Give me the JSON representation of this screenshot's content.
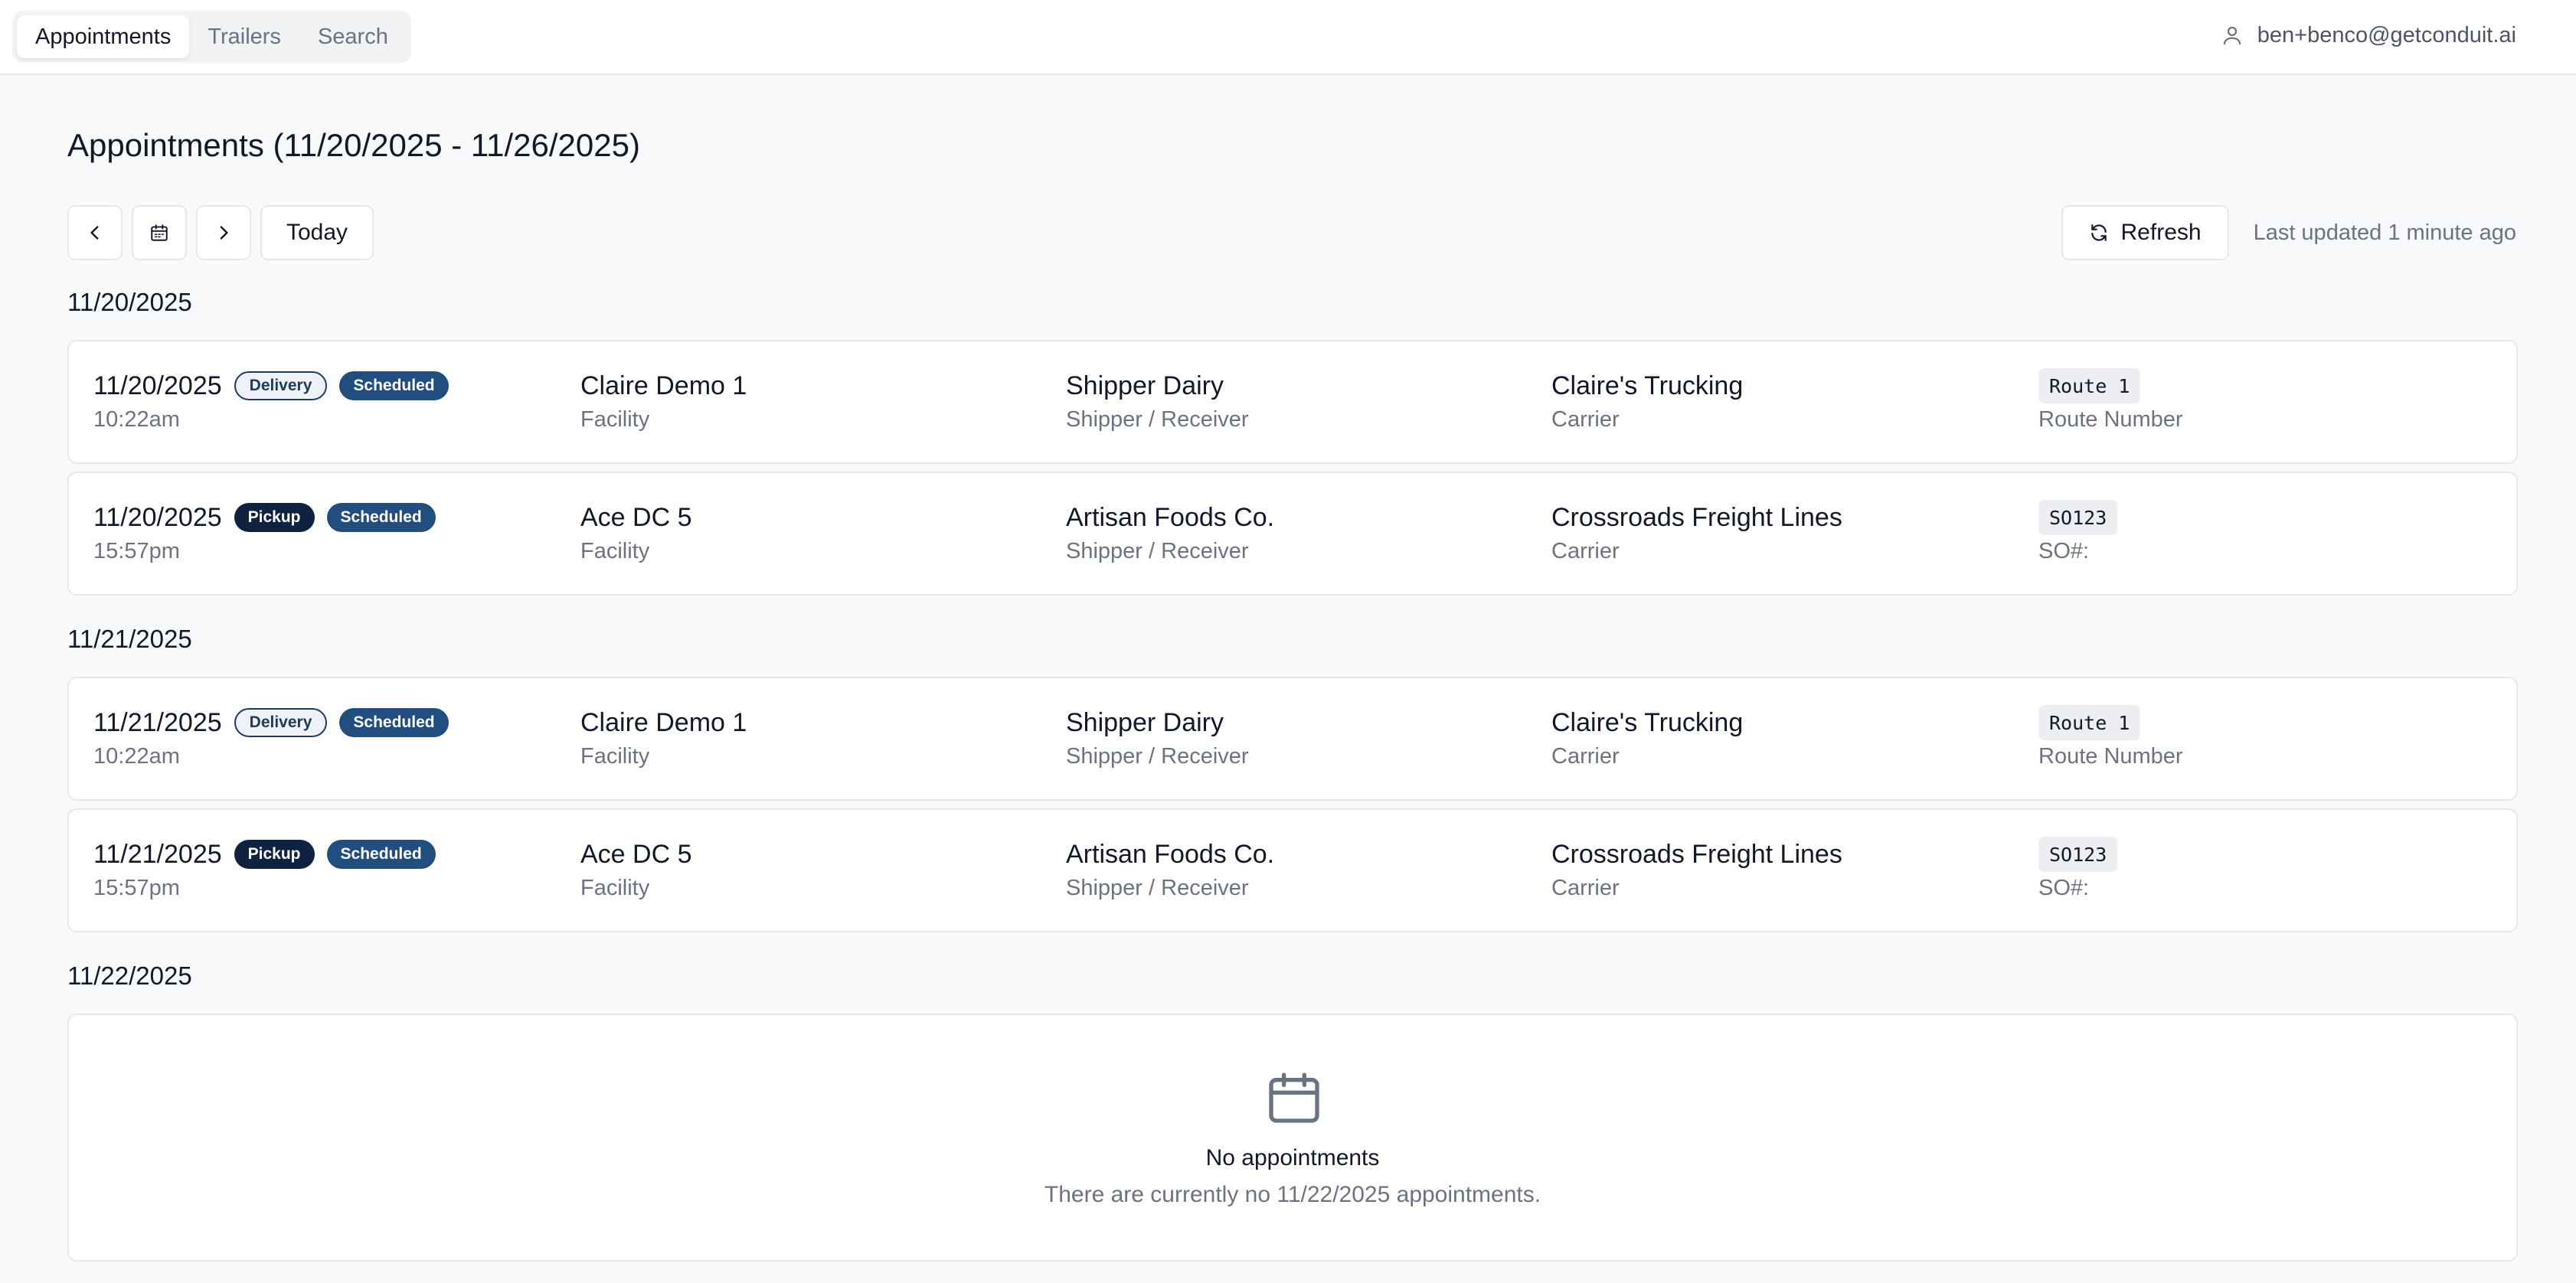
{
  "header": {
    "tabs": [
      {
        "label": "Appointments",
        "active": true
      },
      {
        "label": "Trailers",
        "active": false
      },
      {
        "label": "Search",
        "active": false
      }
    ],
    "user_email": "ben+benco@getconduit.ai"
  },
  "page": {
    "title": "Appointments (11/20/2025 - 11/26/2025)"
  },
  "toolbar": {
    "today_label": "Today",
    "refresh_label": "Refresh",
    "last_updated": "Last updated 1 minute ago"
  },
  "columns": {
    "facility_label": "Facility",
    "shipper_label": "Shipper / Receiver",
    "carrier_label": "Carrier"
  },
  "sections": [
    {
      "date": "11/20/2025",
      "appointments": [
        {
          "date": "11/20/2025",
          "time": "10:22am",
          "type": "Delivery",
          "status": "Scheduled",
          "facility": "Claire Demo 1",
          "shipper": "Shipper Dairy",
          "carrier": "Claire's Trucking",
          "ref_value": "Route 1",
          "ref_label": "Route Number"
        },
        {
          "date": "11/20/2025",
          "time": "15:57pm",
          "type": "Pickup",
          "status": "Scheduled",
          "facility": "Ace DC 5",
          "shipper": "Artisan Foods Co.",
          "carrier": "Crossroads Freight Lines",
          "ref_value": "SO123",
          "ref_label": "SO#:"
        }
      ]
    },
    {
      "date": "11/21/2025",
      "appointments": [
        {
          "date": "11/21/2025",
          "time": "10:22am",
          "type": "Delivery",
          "status": "Scheduled",
          "facility": "Claire Demo 1",
          "shipper": "Shipper Dairy",
          "carrier": "Claire's Trucking",
          "ref_value": "Route 1",
          "ref_label": "Route Number"
        },
        {
          "date": "11/21/2025",
          "time": "15:57pm",
          "type": "Pickup",
          "status": "Scheduled",
          "facility": "Ace DC 5",
          "shipper": "Artisan Foods Co.",
          "carrier": "Crossroads Freight Lines",
          "ref_value": "SO123",
          "ref_label": "SO#:"
        }
      ]
    },
    {
      "date": "11/22/2025",
      "empty": {
        "title": "No appointments",
        "description": "There are currently no 11/22/2025 appointments."
      }
    }
  ],
  "colors": {
    "badge_dark": "#0f2240",
    "badge_blue": "#224d7f",
    "background": "#f8f9fb"
  },
  "icons": [
    "user-icon",
    "chevron-left-icon",
    "calendar-icon",
    "chevron-right-icon",
    "refresh-icon"
  ]
}
